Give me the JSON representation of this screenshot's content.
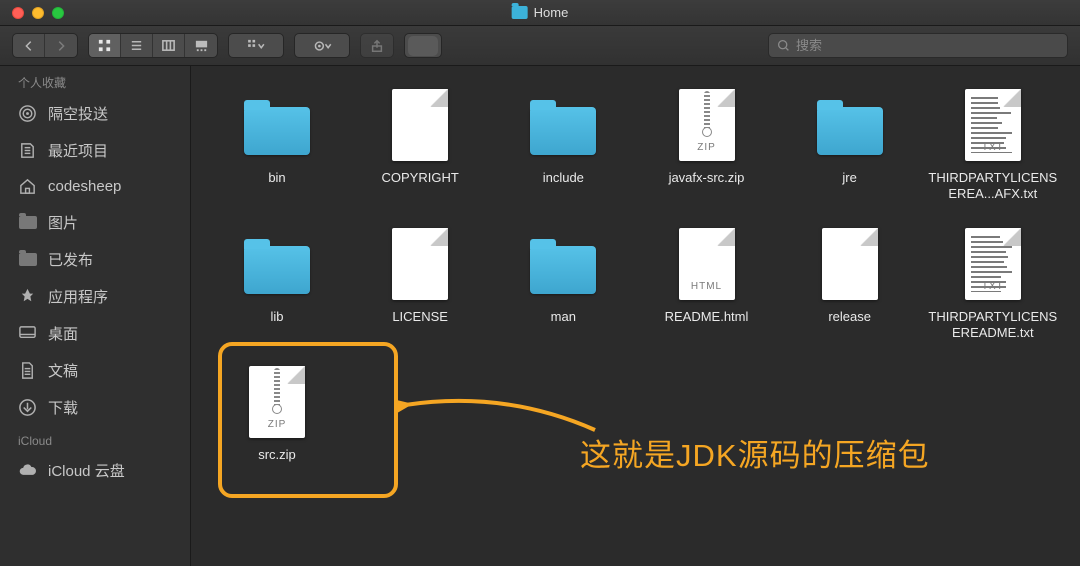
{
  "window": {
    "title": "Home"
  },
  "search": {
    "placeholder": "搜索"
  },
  "sidebar": {
    "sections": [
      {
        "title": "个人收藏",
        "items": [
          {
            "label": "隔空投送",
            "icon": "airdrop-icon"
          },
          {
            "label": "最近项目",
            "icon": "recents-icon"
          },
          {
            "label": "codesheep",
            "icon": "home-icon"
          },
          {
            "label": "图片",
            "icon": "folder-icon"
          },
          {
            "label": "已发布",
            "icon": "folder-icon"
          },
          {
            "label": "应用程序",
            "icon": "apps-icon"
          },
          {
            "label": "桌面",
            "icon": "desktop-icon"
          },
          {
            "label": "文稿",
            "icon": "documents-icon"
          },
          {
            "label": "下载",
            "icon": "downloads-icon"
          }
        ]
      },
      {
        "title": "iCloud",
        "items": [
          {
            "label": "iCloud 云盘",
            "icon": "cloud-icon"
          }
        ]
      }
    ]
  },
  "files": [
    {
      "name": "bin",
      "type": "folder"
    },
    {
      "name": "COPYRIGHT",
      "type": "file"
    },
    {
      "name": "include",
      "type": "folder"
    },
    {
      "name": "javafx-src.zip",
      "type": "zip"
    },
    {
      "name": "jre",
      "type": "folder"
    },
    {
      "name": "THIRDPARTYLICENSEREA...AFX.txt",
      "type": "txt"
    },
    {
      "name": "lib",
      "type": "folder"
    },
    {
      "name": "LICENSE",
      "type": "file"
    },
    {
      "name": "man",
      "type": "folder"
    },
    {
      "name": "README.html",
      "type": "html"
    },
    {
      "name": "release",
      "type": "file"
    },
    {
      "name": "THIRDPARTYLICENSEREADME.txt",
      "type": "txt"
    },
    {
      "name": "src.zip",
      "type": "zip"
    }
  ],
  "annotation": {
    "text": "这就是JDK源码的压缩包",
    "highlighted_file": "src.zip"
  },
  "file_type_badges": {
    "zip": "ZIP",
    "txt": "TXT",
    "html": "HTML"
  },
  "colors": {
    "accent_orange": "#f5a623",
    "folder_blue": "#3ea6cf"
  }
}
